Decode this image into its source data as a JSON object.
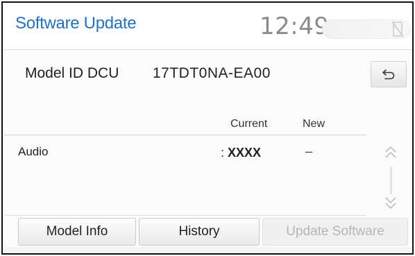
{
  "header": {
    "title": "Software Update",
    "clock": "12:49",
    "status_icon": "no-signal-icon"
  },
  "model": {
    "label": "Model ID DCU",
    "value": "17TDT0NA-EA00",
    "back_icon": "back-arrow-icon"
  },
  "table": {
    "columns": [
      "Current",
      "New"
    ],
    "rows": [
      {
        "label": "Audio",
        "current_prefix": ": ",
        "current": "XXXX",
        "new": "–"
      }
    ]
  },
  "scroll": {
    "up_icon": "double-chevron-up-icon",
    "down_icon": "double-chevron-down-icon"
  },
  "buttons": {
    "model_info": "Model Info",
    "history": "History",
    "update_software": "Update Software"
  },
  "colors": {
    "title": "#1e72c8",
    "clock": "#8a8a8a",
    "disabled_text": "#b5b5b5"
  }
}
